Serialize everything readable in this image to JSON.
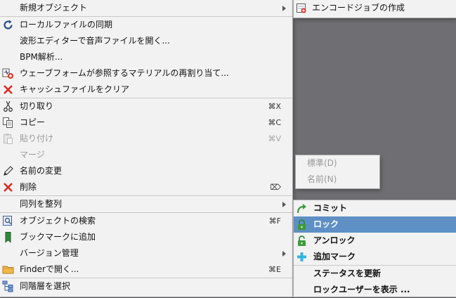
{
  "main": {
    "items": [
      {
        "label": "新規オブジェクト",
        "icon": "none",
        "submenu": true
      },
      {
        "label": "ローカルファイルの同期",
        "icon": "refresh-icon"
      },
      {
        "label": "波形エディターで音声ファイルを開く...",
        "icon": "none"
      },
      {
        "label": "BPM解析...",
        "icon": "none"
      },
      {
        "label": "ウェーブフォームが参照するマテリアルの再割り当て...",
        "icon": "reassign-material-icon"
      },
      {
        "label": "キャッシュファイルをクリア",
        "icon": "red-x-icon"
      },
      {
        "label": "切り取り",
        "icon": "scissors-icon",
        "shortcut": "⌘X"
      },
      {
        "label": "コピー",
        "icon": "copy-icon",
        "shortcut": "⌘C"
      },
      {
        "label": "貼り付け",
        "icon": "paste-icon",
        "shortcut": "⌘V",
        "disabled": true
      },
      {
        "label": "マージ",
        "icon": "none",
        "disabled": true
      },
      {
        "label": "名前の変更",
        "icon": "pencil-icon"
      },
      {
        "label": "削除",
        "icon": "red-x-icon",
        "shortcut": "⌦"
      },
      {
        "label": "同列を整列",
        "icon": "none",
        "submenu": true
      },
      {
        "label": "オブジェクトの検索",
        "icon": "find-object-icon",
        "shortcut": "⌘F"
      },
      {
        "label": "ブックマークに追加",
        "icon": "bookmark-icon"
      },
      {
        "label": "バージョン管理",
        "icon": "none",
        "submenu": true
      },
      {
        "label": "Finderで開く...",
        "icon": "folder-icon",
        "shortcut": "⌘E"
      },
      {
        "label": "同階層を選択",
        "icon": "hierarchy-icon"
      }
    ]
  },
  "sub_new": {
    "items": [
      {
        "label": "エンコードジョブの作成",
        "icon": "encode-job-icon"
      }
    ]
  },
  "sub_align": {
    "items": [
      {
        "label": "標準(D)",
        "disabled": true
      },
      {
        "label": "名前(N)",
        "disabled": true
      }
    ]
  },
  "sub_version": {
    "items": [
      {
        "label": "コミット",
        "icon": "commit-arrow-icon"
      },
      {
        "label": "ロック",
        "icon": "lock-icon",
        "highlight": true
      },
      {
        "label": "アンロック",
        "icon": "unlock-icon"
      },
      {
        "label": "追加マーク",
        "icon": "plus-icon"
      },
      {
        "label": "ステータスを更新",
        "icon": "none"
      },
      {
        "label": "ロックユーザーを表示 ...",
        "icon": "none"
      }
    ]
  },
  "colors": {
    "highlight": "#5e8fc5",
    "menu_bg": "#f2f2f2",
    "desktop_bg": "#6f6f73"
  }
}
